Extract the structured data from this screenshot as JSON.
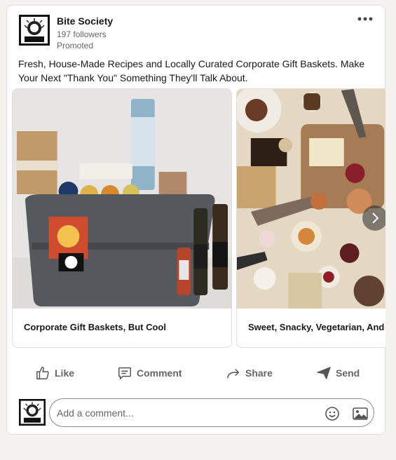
{
  "post": {
    "company_name": "Bite Society",
    "followers": "197 followers",
    "promoted": "Promoted",
    "logo_text": "BITE",
    "text": "Fresh, House-Made Recipes and Locally Curated Corporate Gift Baskets. Make Your Next \"Thank You\" Something They'll Talk About."
  },
  "carousel": {
    "slides": [
      {
        "caption": "Corporate Gift Baskets, But Cool"
      },
      {
        "caption": "Sweet, Snacky, Vegetarian, And"
      }
    ]
  },
  "actions": {
    "like": "Like",
    "comment": "Comment",
    "share": "Share",
    "send": "Send"
  },
  "comment": {
    "placeholder": "Add a comment..."
  },
  "icons": {
    "more": "more-horizontal-icon",
    "next": "chevron-right-icon",
    "like": "thumbs-up-icon",
    "comment": "speech-bubble-icon",
    "share": "share-arrow-icon",
    "send": "paper-plane-icon",
    "emoji": "smiley-icon",
    "image": "image-icon"
  },
  "colors": {
    "page_bg": "#f3f2ef",
    "card_bg": "#ffffff",
    "text_primary": "#191919",
    "text_secondary": "#666666"
  }
}
